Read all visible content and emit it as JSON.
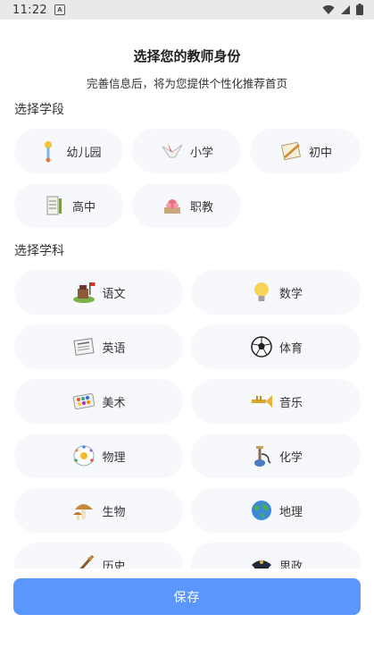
{
  "status_bar": {
    "time": "11:22",
    "notification_glyph": "A"
  },
  "header": {
    "title": "选择您的教师身份",
    "subtitle": "完善信息后，将为您提供个性化推荐首页"
  },
  "stage_section": {
    "label": "选择学段",
    "items": [
      {
        "label": "幼儿园",
        "icon": "baby-toy-icon"
      },
      {
        "label": "小学",
        "icon": "paper-crane-icon"
      },
      {
        "label": "初中",
        "icon": "notepad-pencil-icon"
      },
      {
        "label": "高中",
        "icon": "scroll-document-icon"
      },
      {
        "label": "职教",
        "icon": "lotus-box-icon"
      }
    ]
  },
  "subject_section": {
    "label": "选择学科",
    "items": [
      {
        "label": "语文",
        "icon": "great-wall-icon"
      },
      {
        "label": "数学",
        "icon": "lightbulb-icon"
      },
      {
        "label": "英语",
        "icon": "newspaper-icon"
      },
      {
        "label": "体育",
        "icon": "soccer-ball-icon"
      },
      {
        "label": "美术",
        "icon": "paint-palette-icon"
      },
      {
        "label": "音乐",
        "icon": "trumpet-icon"
      },
      {
        "label": "物理",
        "icon": "atom-icon"
      },
      {
        "label": "化学",
        "icon": "hookah-flask-icon"
      },
      {
        "label": "生物",
        "icon": "mushroom-icon"
      },
      {
        "label": "地理",
        "icon": "globe-icon"
      },
      {
        "label": "历史",
        "icon": "quill-icon"
      },
      {
        "label": "思政",
        "icon": "police-cap-icon"
      }
    ]
  },
  "save_button": {
    "label": "保存"
  },
  "colors": {
    "accent": "#5a96fb",
    "chip_bg": "#f6f8fb"
  }
}
